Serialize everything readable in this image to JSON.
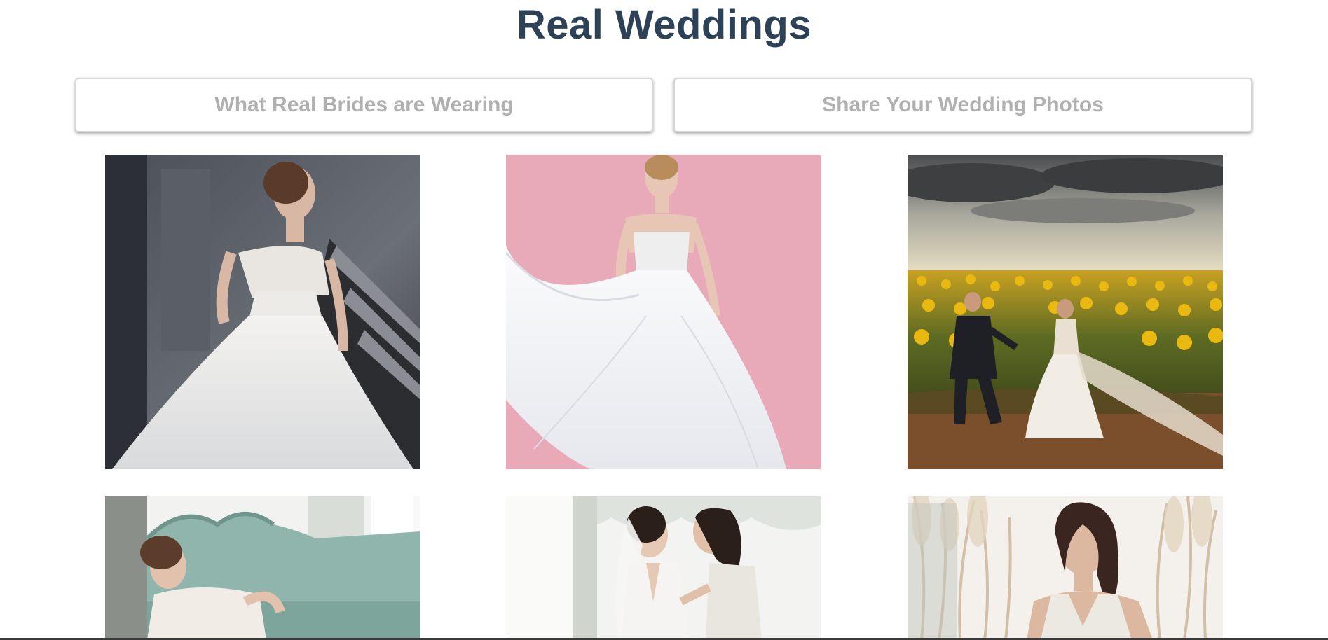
{
  "header": {
    "title": "Real Weddings"
  },
  "actions": {
    "left_label": "What Real Brides are Wearing",
    "right_label": "Share Your Wedding Photos"
  },
  "gallery": {
    "photos": [
      {
        "subject": "bride-ballgown-staircase-photo"
      },
      {
        "subject": "bride-tulle-gown-pink-backdrop-photo"
      },
      {
        "subject": "couple-sunflower-field-photo"
      },
      {
        "subject": "bride-reclining-green-sofa-photo"
      },
      {
        "subject": "bride-with-bridesmaid-photo"
      },
      {
        "subject": "bride-pampas-grass-photo"
      }
    ]
  },
  "colors": {
    "title": "#2e4257",
    "button_text": "#b0b0b0",
    "button_border": "#d6d6d6"
  }
}
